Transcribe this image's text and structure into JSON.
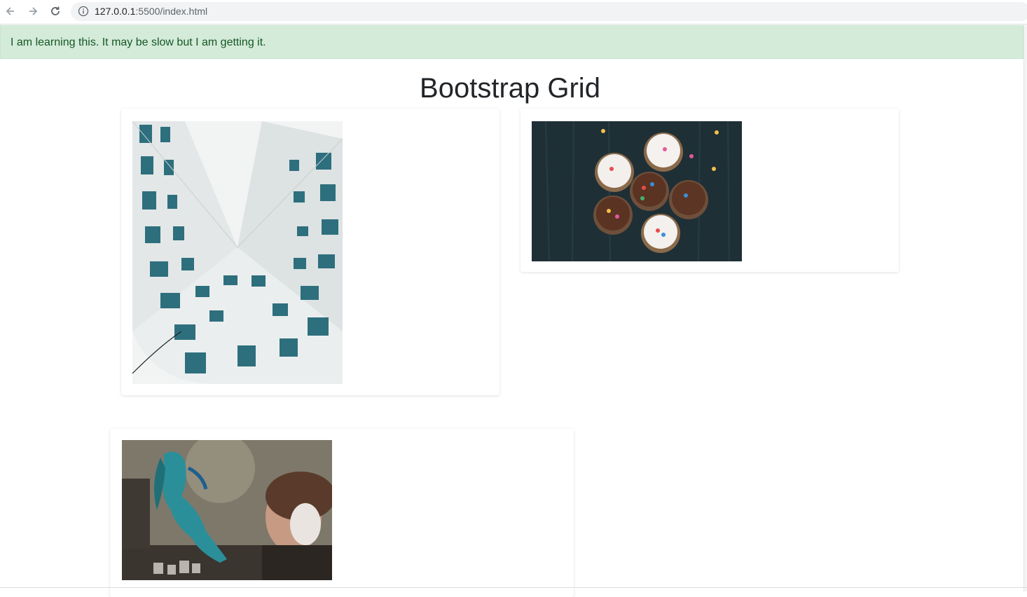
{
  "browser": {
    "url_host": "127.0.0.1",
    "url_rest": ":5500/index.html"
  },
  "alert": {
    "text": "I am learning this. It may be slow but I am getting it."
  },
  "page": {
    "title": "Bootstrap Grid"
  },
  "images": [
    {
      "name": "architecture-photo",
      "icon": "building-windows"
    },
    {
      "name": "cupcakes-photo",
      "icon": "cupcakes"
    },
    {
      "name": "graffiti-photo",
      "icon": "graffiti-wall"
    }
  ],
  "colors": {
    "alert_bg": "#d4ebd9",
    "alert_text": "#155724",
    "title_text": "#212529"
  }
}
